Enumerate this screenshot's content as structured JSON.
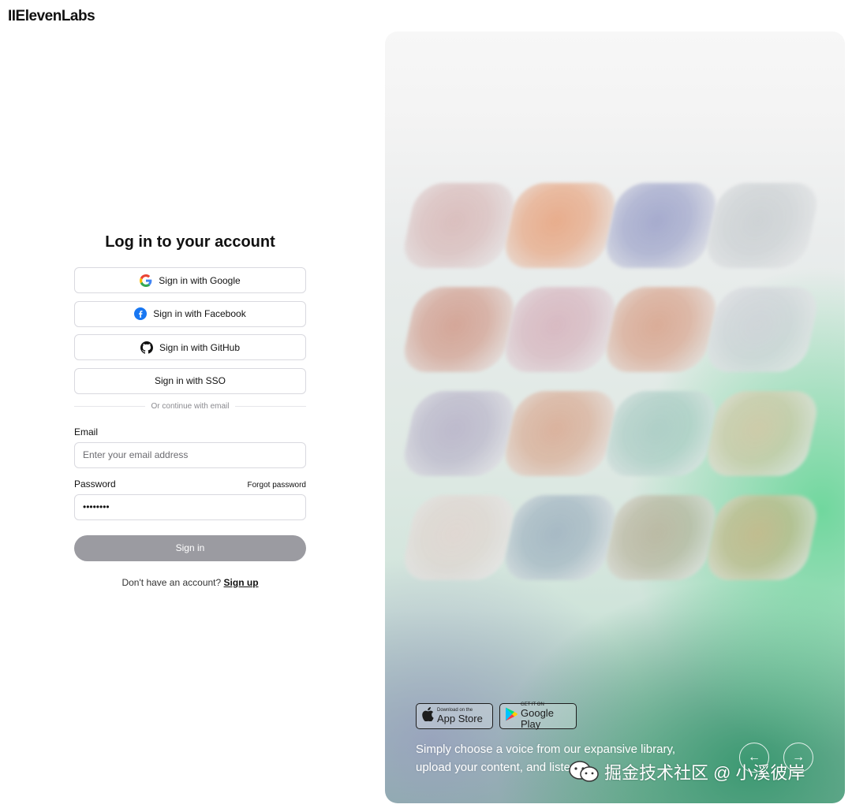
{
  "brand": {
    "logo_text": "IIElevenLabs"
  },
  "login": {
    "title": "Log in to your account",
    "oauth": [
      {
        "label": "Sign in with Google",
        "icon": "google-icon"
      },
      {
        "label": "Sign in with Facebook",
        "icon": "facebook-icon"
      },
      {
        "label": "Sign in with GitHub",
        "icon": "github-icon"
      },
      {
        "label": "Sign in with SSO",
        "icon": ""
      }
    ],
    "divider_text": "Or continue with email",
    "email": {
      "label": "Email",
      "placeholder": "Enter your email address",
      "value": ""
    },
    "password": {
      "label": "Password",
      "forgot_label": "Forgot password",
      "value": "••••••••"
    },
    "submit_label": "Sign in",
    "signup_prompt": "Don't have an account?",
    "signup_link": "Sign up"
  },
  "promo": {
    "app_store": {
      "small": "Download on the",
      "big": "App Store"
    },
    "google_play": {
      "small": "GET IT ON",
      "big": "Google Play"
    },
    "tagline_line1": "Simply choose a voice from our expansive library,",
    "tagline_line2": "upload your content, and listen",
    "prev_icon": "arrow-left-icon",
    "next_icon": "arrow-right-icon",
    "tile_colors": [
      "#d7b7b6",
      "#e7a27c",
      "#9aa0c8",
      "#c9ced1",
      "#d19a8a",
      "#d6b2bc",
      "#d8a189",
      "#cfd2d8",
      "#b7b2c8",
      "#d9a991",
      "#a8cbc3",
      "#d4c8a6",
      "#e1d5d0",
      "#9fb2c0",
      "#b9b39c",
      "#c9b789"
    ]
  },
  "watermark": {
    "text": "掘金技术社区 @ 小溪彼岸",
    "icon": "wechat-icon"
  }
}
